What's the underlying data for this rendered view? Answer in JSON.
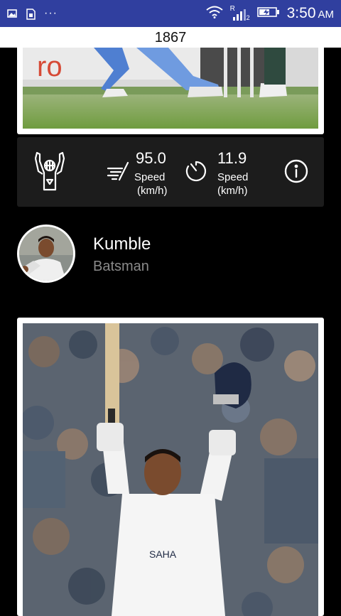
{
  "status_bar": {
    "time": "3:50",
    "ampm": "AM",
    "overflow": "···",
    "signal_label": "R",
    "sim_slot": "2",
    "icons": [
      "gallery-icon",
      "sim-card-icon",
      "wifi-icon",
      "signal-icon",
      "battery-charging-icon"
    ]
  },
  "header": {
    "title": "1867"
  },
  "stats": {
    "bowling_speed": {
      "value": "95.0",
      "label_line1": "Speed",
      "label_line2": "(km/h)"
    },
    "ball_speed": {
      "value": "11.9",
      "label_line1": "Speed",
      "label_line2": "(km/h)"
    },
    "icons": [
      "wicketkeeper-icon",
      "speed-icon",
      "stopwatch-icon",
      "info-icon"
    ]
  },
  "player": {
    "name": "Kumble",
    "role": "Batsman"
  },
  "colors": {
    "status_bar": "#303f9f",
    "background": "#000000",
    "stats_bar": "#1c1c1c",
    "role_text": "#8a8a8a"
  }
}
